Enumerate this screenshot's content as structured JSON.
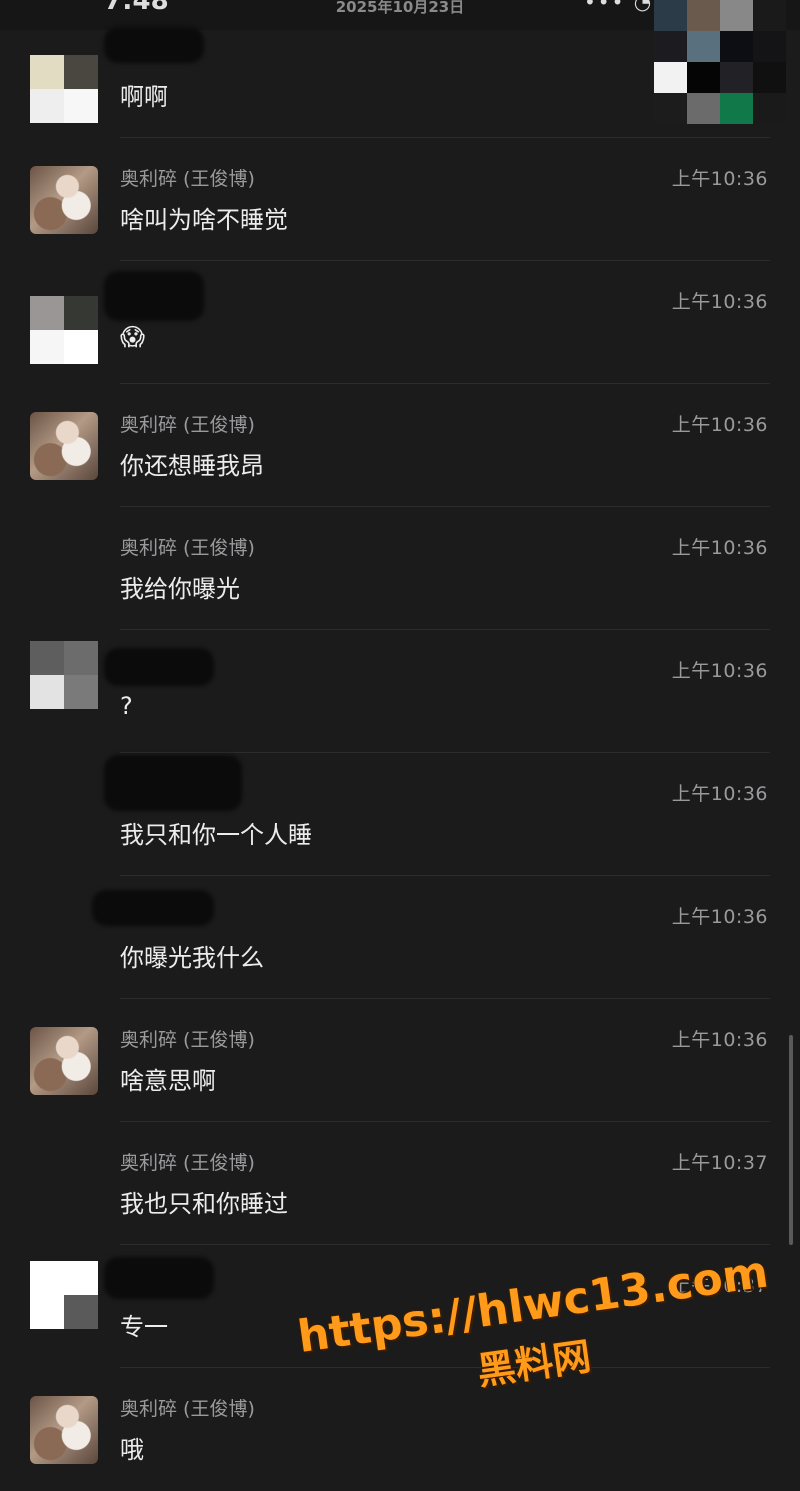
{
  "status_bar": {
    "time": "7:48",
    "date": "2025年10月23日",
    "icons": "••• ◔"
  },
  "messages": [
    {
      "sender": "",
      "time": "",
      "text": "啊啊",
      "avatar": "mosaic-a"
    },
    {
      "sender": "奥利碎 (王俊博)",
      "time": "上午10:36",
      "text": "啥叫为啥不睡觉",
      "avatar": "photo"
    },
    {
      "sender": "",
      "time": "上午10:36",
      "text": "😱",
      "avatar": "mosaic-b"
    },
    {
      "sender": "奥利碎 (王俊博)",
      "time": "上午10:36",
      "text": "你还想睡我昂",
      "avatar": "photo"
    },
    {
      "sender": "奥利碎 (王俊博)",
      "time": "上午10:36",
      "text": "我给你曝光",
      "avatar": "none"
    },
    {
      "sender": "",
      "time": "上午10:36",
      "text": "?",
      "avatar": "mosaic-c"
    },
    {
      "sender": "",
      "time": "上午10:36",
      "text": "我只和你一个人睡",
      "avatar": "none"
    },
    {
      "sender": "",
      "time": "上午10:36",
      "text": "你曝光我什么",
      "avatar": "none"
    },
    {
      "sender": "奥利碎 (王俊博)",
      "time": "上午10:36",
      "text": "啥意思啊",
      "avatar": "photo"
    },
    {
      "sender": "奥利碎 (王俊博)",
      "time": "上午10:37",
      "text": "我也只和你睡过",
      "avatar": "none"
    },
    {
      "sender": "",
      "time": "上午10:37",
      "text": "专一",
      "avatar": "mosaic-d"
    },
    {
      "sender": "奥利碎 (王俊博)",
      "time": "",
      "text": "哦",
      "avatar": "photo"
    }
  ],
  "watermark": {
    "url": "https://hlwc13.com",
    "name": "黑料网"
  },
  "colors": {
    "background": "#1b1b1c",
    "watermark": "#ff9a1a"
  }
}
